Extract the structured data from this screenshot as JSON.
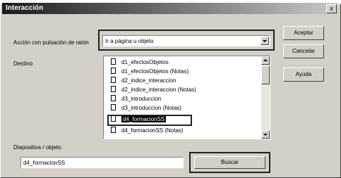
{
  "window": {
    "title": "Interacción",
    "close_glyph": "x"
  },
  "action": {
    "label": "Acción con pulsación de ratón",
    "value": "Ir a página u objeto"
  },
  "destino": {
    "label": "Destino",
    "items": [
      "d1_efectosObjetos",
      "d1_efectosObjetos (Notas)",
      "d2_indice_interaccion",
      "d2_indice_interaccion (Notas)",
      "d3_introduccion",
      "d3_introduccion (Notas)",
      "d4_formacionSS",
      "d4_formacionSS (Notas)"
    ],
    "selected_index": 6
  },
  "diapositiva": {
    "label": "Diapositiva / objeto",
    "value": "d4_formacionSS"
  },
  "buttons": {
    "aceptar": "Aceptar",
    "cancelar": "Cancelar",
    "ayuda": "Ayuda",
    "buscar": "Buscar"
  },
  "icons": {
    "list_item": "document-icon",
    "dropdown": "chevron-down-icon"
  }
}
